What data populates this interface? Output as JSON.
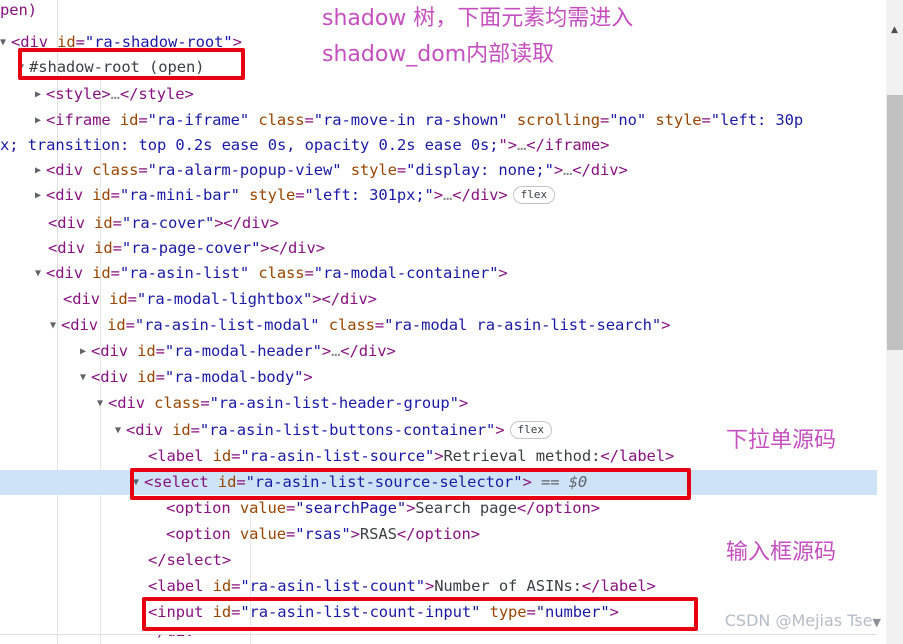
{
  "app": {
    "title": "Chrome DevTools Elements panel — Shadow DOM tree"
  },
  "dom_tree": {
    "lines": [
      {
        "id": "l0",
        "indent": 0,
        "text": "pen)"
      },
      {
        "id": "l1",
        "indent": 1,
        "text": "<div id=\"ra-shadow-root\">"
      },
      {
        "id": "l2",
        "indent": 2,
        "text": "#shadow-root (open)"
      },
      {
        "id": "l3",
        "indent": 3,
        "text": "<style>…</style>"
      },
      {
        "id": "l4",
        "indent": 3,
        "text": "<iframe id=\"ra-iframe\" class=\"ra-move-in ra-shown\" scrolling=\"no\" style=\"left: 30p"
      },
      {
        "id": "l5",
        "indent": 0,
        "text": "x; transition: top 0.2s ease 0s, opacity 0.2s ease 0s;\">…</iframe>"
      },
      {
        "id": "l6",
        "indent": 3,
        "text": "<div class=\"ra-alarm-popup-view\" style=\"display: none;\">…</div>"
      },
      {
        "id": "l7",
        "indent": 3,
        "text": "<div id=\"ra-mini-bar\" style=\"left: 301px;\">…</div>",
        "badge": "flex"
      },
      {
        "id": "l8",
        "indent": 3,
        "text": "<div id=\"ra-cover\"></div>"
      },
      {
        "id": "l9",
        "indent": 3,
        "text": "<div id=\"ra-page-cover\"></div>"
      },
      {
        "id": "l10",
        "indent": 3,
        "text": "<div id=\"ra-asin-list\" class=\"ra-modal-container\">"
      },
      {
        "id": "l11",
        "indent": 4,
        "text": "<div id=\"ra-modal-lightbox\"></div>"
      },
      {
        "id": "l12",
        "indent": 4,
        "text": "<div id=\"ra-asin-list-modal\" class=\"ra-modal ra-asin-list-search\">"
      },
      {
        "id": "l13",
        "indent": 5,
        "text": "<div id=\"ra-modal-header\">…</div>"
      },
      {
        "id": "l14",
        "indent": 5,
        "text": "<div id=\"ra-modal-body\">"
      },
      {
        "id": "l15",
        "indent": 6,
        "text": "<div class=\"ra-asin-list-header-group\">"
      },
      {
        "id": "l16",
        "indent": 7,
        "text": "<div id=\"ra-asin-list-buttons-container\">",
        "badge": "flex"
      },
      {
        "id": "l17",
        "indent": 8,
        "text": "<label id=\"ra-asin-list-source\">Retrieval method:</label>"
      },
      {
        "id": "l18",
        "indent": 8,
        "text": "<select id=\"ra-asin-list-source-selector\"> == $0"
      },
      {
        "id": "l19",
        "indent": 9,
        "text": "<option value=\"searchPage\">Search page</option>"
      },
      {
        "id": "l20",
        "indent": 9,
        "text": "<option value=\"rsas\">RSAS</option>"
      },
      {
        "id": "l21",
        "indent": 8,
        "text": "</select>"
      },
      {
        "id": "l22",
        "indent": 8,
        "text": "<label id=\"ra-asin-list-count\">Number of ASINs:</label>"
      },
      {
        "id": "l23",
        "indent": 8,
        "text": "<input id=\"ra-asin-list-count-input\" type=\"number\">"
      }
    ],
    "selected_line_id": "l18",
    "badge_label": "flex"
  },
  "annotations": {
    "notes": [
      {
        "id": "note-shadow-tree",
        "text": "shadow 树，下面元素均需进入"
      },
      {
        "id": "note-shadow-dom",
        "text": "shadow_dom内部读取"
      },
      {
        "id": "note-select-src",
        "text": "下拉单源码"
      },
      {
        "id": "note-input-src",
        "text": "输入框源码"
      }
    ],
    "highlight_color": "#e60012",
    "note_color": "#c64fc0",
    "boxes": [
      {
        "id": "box-shadow-root",
        "target": "l2"
      },
      {
        "id": "box-select",
        "target": "l18"
      },
      {
        "id": "box-input",
        "target": "l23"
      }
    ]
  },
  "scrollbar": {
    "up_arrow_glyph": "▲",
    "position_percent": 15
  },
  "watermark": {
    "text": "CSDN @Mejias Tse",
    "caret_glyph": "▼"
  },
  "glyphs": {
    "expanded_triangle": "▼",
    "collapsed_triangle": "▶"
  }
}
